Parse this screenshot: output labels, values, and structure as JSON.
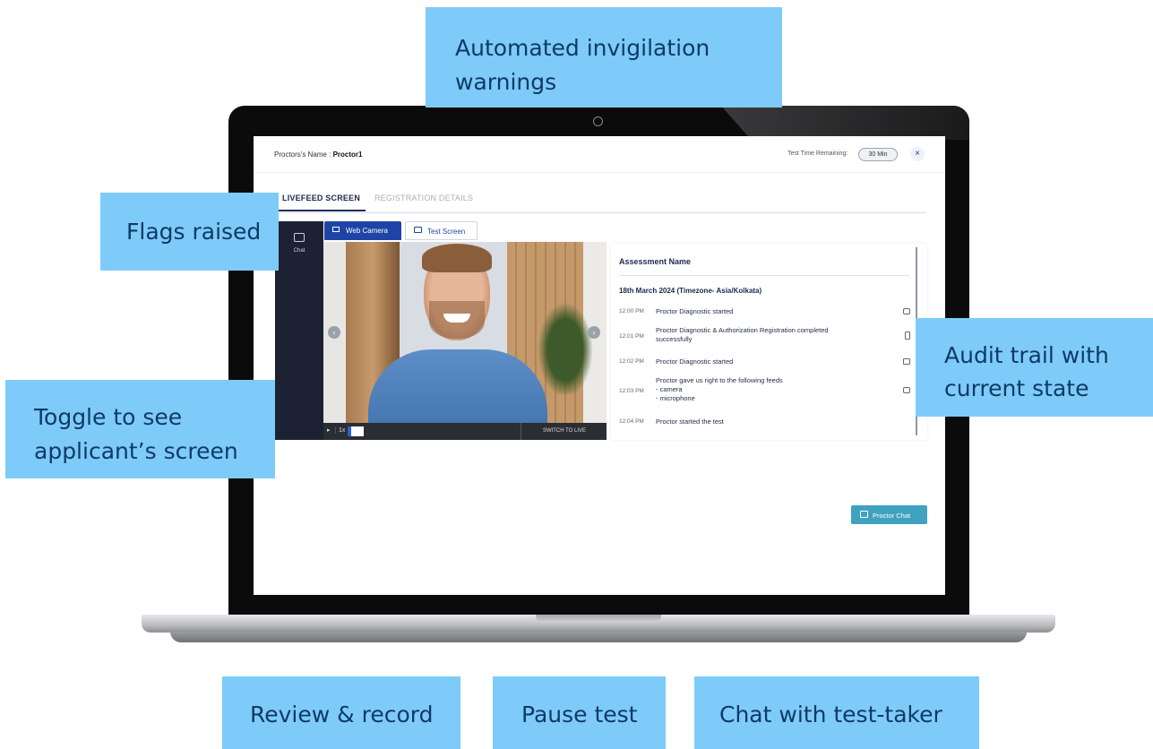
{
  "callouts": {
    "warnings_line1": "Automated invigilation",
    "warnings_line2": "warnings",
    "flags": "Flags raised",
    "toggle_line1": "Toggle to see",
    "toggle_line2": "applicant’s screen",
    "audit_line1": "Audit trail with",
    "audit_line2": "current state",
    "review": "Review & record",
    "pause": "Pause test",
    "chat": "Chat with test-taker"
  },
  "header": {
    "proctor_label": "Proctors's Name :",
    "proctor_name": "Proctor1",
    "time_label": "Test Time Remaining:",
    "time_value": "30 Min",
    "close_glyph": "×"
  },
  "tabs": {
    "livefeed": "LIVEFEED SCREEN",
    "registration": "REGISTRATION DETAILS"
  },
  "sidebar": {
    "chat_label": "Chat"
  },
  "feed_toggle": {
    "web_camera": "Web Camera",
    "test_screen": "Test Screen"
  },
  "video": {
    "speed": "1x",
    "switch_live": "SWITCH TO LIVE",
    "play_glyph": "▸",
    "prev_glyph": "‹",
    "next_glyph": "›"
  },
  "audit": {
    "title": "Assessment Name",
    "date": "18th March 2024 (Timezone- Asia/Kolkata)",
    "events": [
      {
        "time": "12:00 PM",
        "text": "Proctor Diagnostic started",
        "icon": "camera-icon"
      },
      {
        "time": "12:01 PM",
        "text": "Proctor Diagnostic & Authorization Registration completed\nsuccessfully",
        "icon": "phone-icon"
      },
      {
        "time": "12:02 PM",
        "text": "Proctor Diagnostic started",
        "icon": "card-icon"
      },
      {
        "time": "12:03 PM",
        "text": "Proctor gave us right to the following feeds\n- camera\n- microphone",
        "icon": "camera-icon"
      },
      {
        "time": "12:04 PM",
        "text": "Proctor started the test",
        "icon": ""
      }
    ]
  },
  "proctor_chat_button": "Proctor Chat",
  "colors": {
    "callout_bg": "#7ecbf9",
    "callout_text": "#0f3a66",
    "primary": "#1e45a6",
    "chat_button": "#3fa2c0",
    "sidebar": "#1c2234"
  }
}
